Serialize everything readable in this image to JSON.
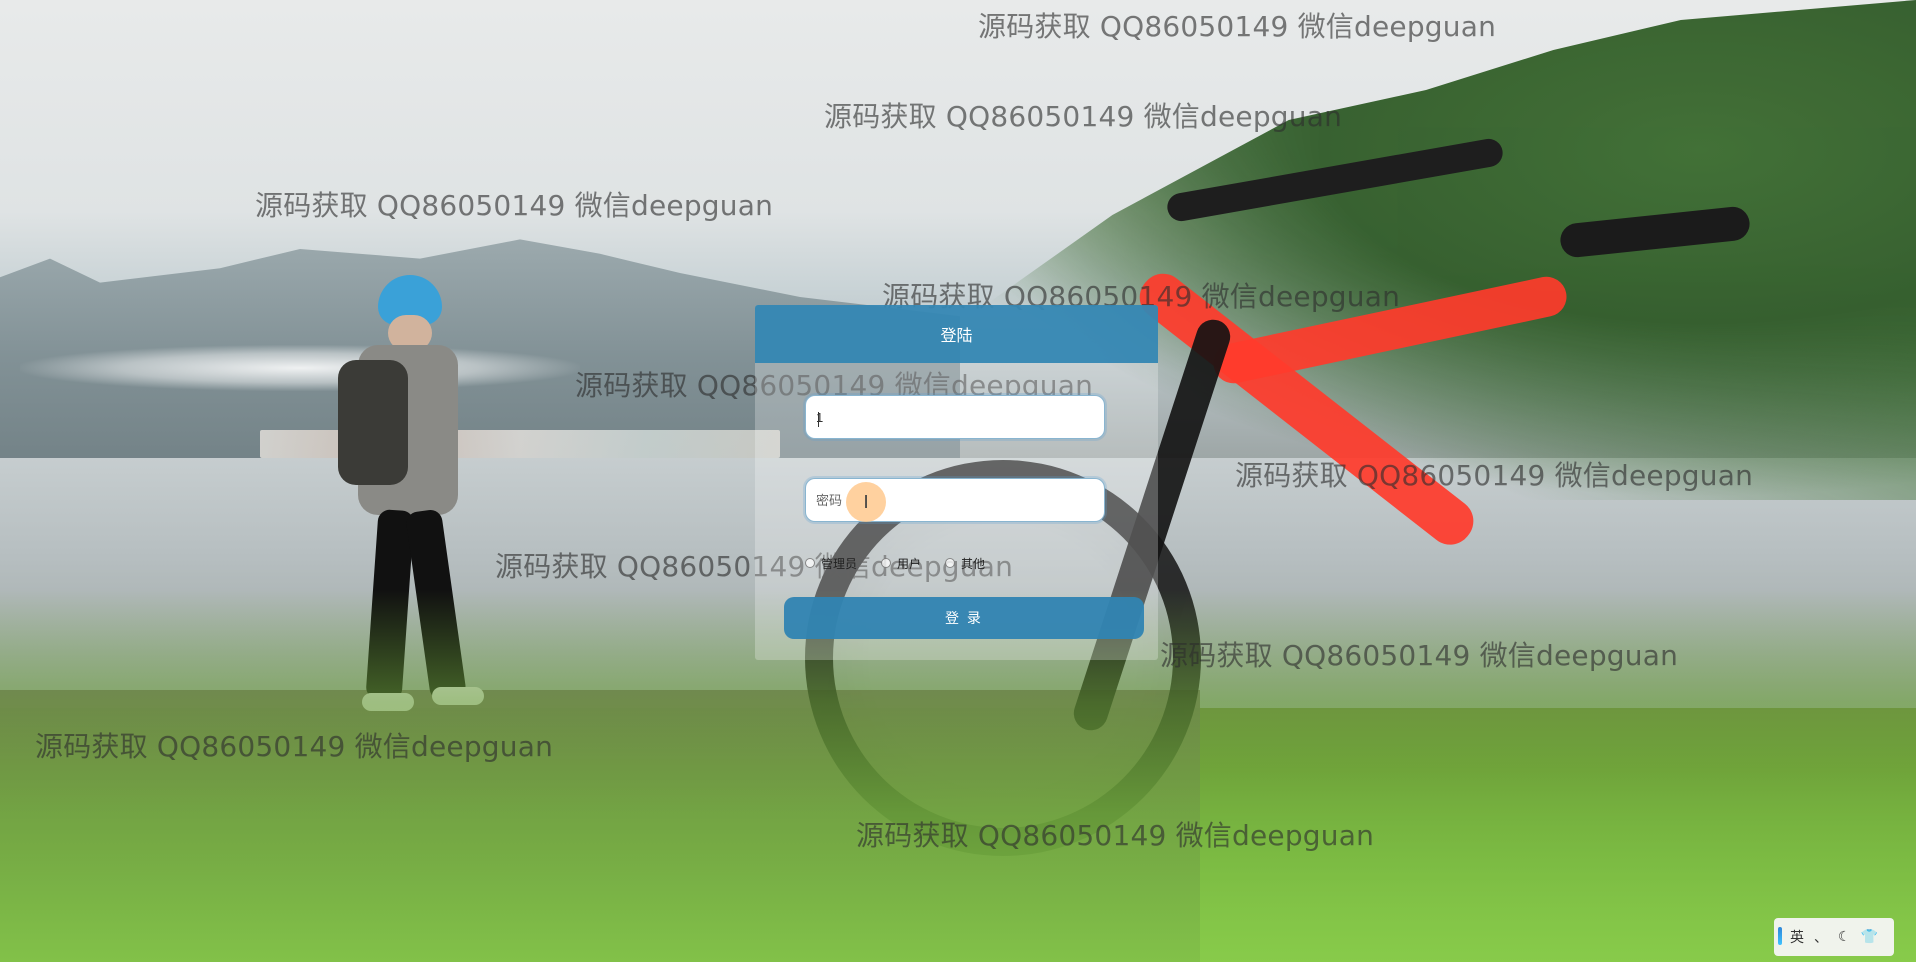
{
  "login_panel": {
    "title": "登陆",
    "username_value": "1",
    "password_placeholder": "密码",
    "roles": [
      "管理员",
      "用户",
      "其他"
    ],
    "login_button": "登 录"
  },
  "watermarks": [
    "源码获取 QQ86050149 微信deepguan",
    "源码获取 QQ86050149 微信deepguan",
    "源码获取 QQ86050149 微信deepguan",
    "源码获取 QQ86050149 微信deepguan",
    "源码获取 QQ86050149 微信deepguan",
    "源码获取 QQ86050149 微信deepguan",
    "源码获取 QQ86050149 微信deepguan",
    "源码获取 QQ86050149 微信deepguan",
    "源码获取 QQ86050149 微信deepguan",
    "源码获取 QQ86050149 微信deepguan"
  ],
  "ime": {
    "language": "英",
    "icons": [
      "punctuation-icon",
      "moon-icon",
      "shirt-icon"
    ]
  },
  "colors": {
    "primary": "#3084b2",
    "panel_overlay": "rgba(255,255,255,.26)"
  }
}
